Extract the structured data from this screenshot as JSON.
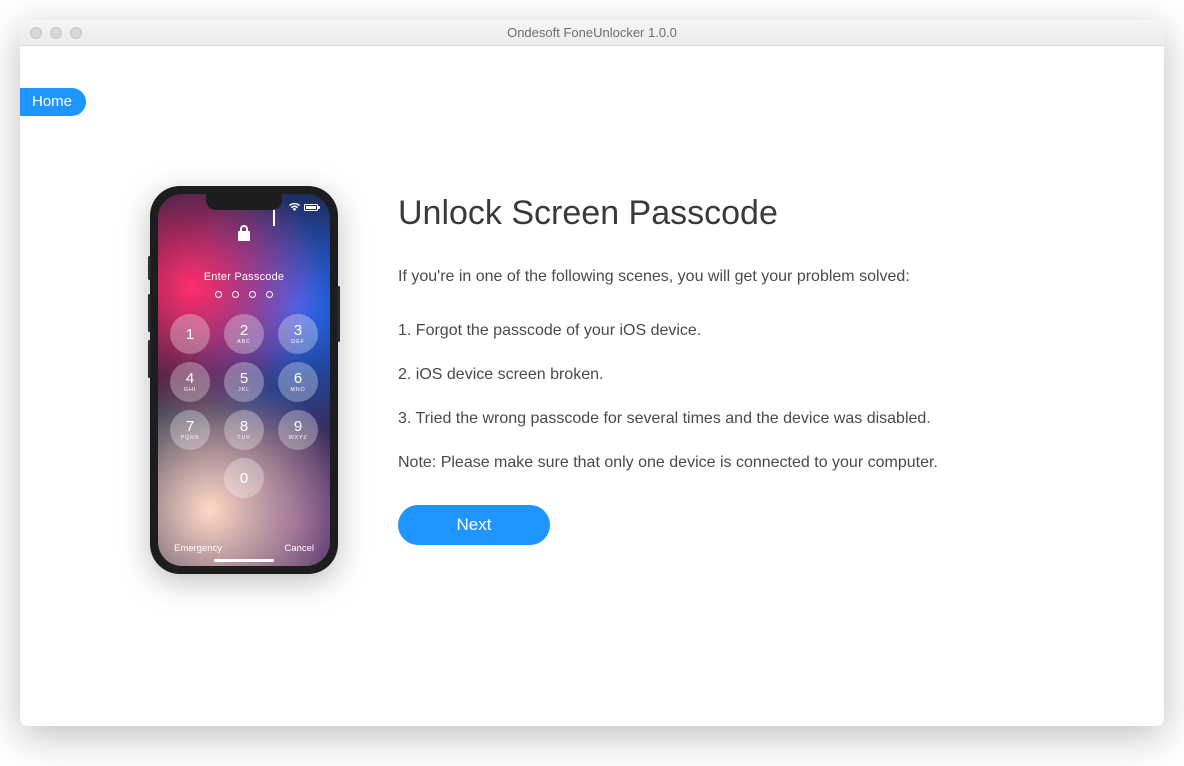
{
  "window": {
    "title": "Ondesoft FoneUnlocker 1.0.0"
  },
  "nav": {
    "home_label": "Home"
  },
  "phone": {
    "enter_passcode": "Enter Passcode",
    "emergency": "Emergency",
    "cancel": "Cancel",
    "keys": {
      "k1": {
        "num": "1",
        "letters": ""
      },
      "k2": {
        "num": "2",
        "letters": "ABC"
      },
      "k3": {
        "num": "3",
        "letters": "DEF"
      },
      "k4": {
        "num": "4",
        "letters": "GHI"
      },
      "k5": {
        "num": "5",
        "letters": "JKL"
      },
      "k6": {
        "num": "6",
        "letters": "MNO"
      },
      "k7": {
        "num": "7",
        "letters": "PQRS"
      },
      "k8": {
        "num": "8",
        "letters": "TUV"
      },
      "k9": {
        "num": "9",
        "letters": "WXYZ"
      },
      "k0": {
        "num": "0",
        "letters": ""
      }
    }
  },
  "main": {
    "heading": "Unlock Screen Passcode",
    "intro": "If you're in one of the following scenes, you will get your problem solved:",
    "item1": "1. Forgot the passcode of your iOS device.",
    "item2": "2. iOS device screen broken.",
    "item3": "3. Tried the wrong passcode for several times and the device was disabled.",
    "note": "Note: Please make sure that only one device is connected to your computer.",
    "next_label": "Next"
  }
}
